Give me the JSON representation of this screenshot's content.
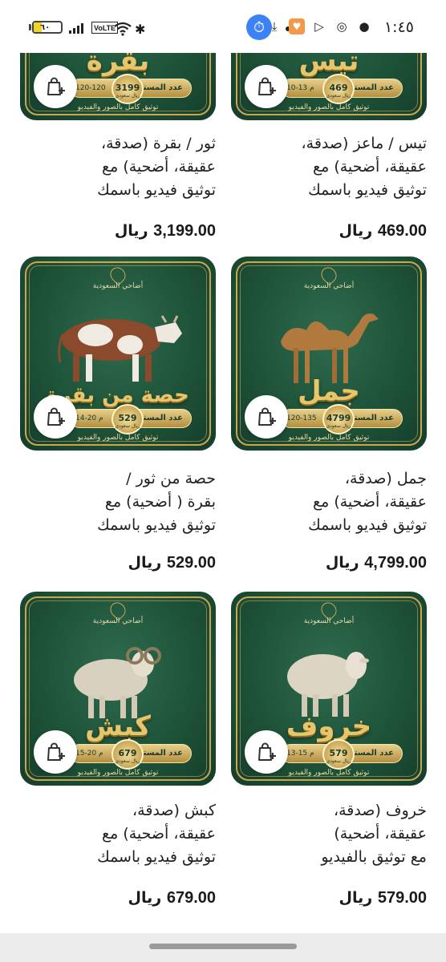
{
  "status_bar": {
    "time": "١:٤٥",
    "battery": "٦٠",
    "network": "VoLTE",
    "network_sup": "7"
  },
  "products": [
    {
      "animal": "cow",
      "banner": "بقرة",
      "title_lines": [
        "ثور / بقرة (صدقة،",
        "عقيقة، أضحية) مع",
        "توثيق فيديو باسمك"
      ],
      "price": "3,199.00",
      "currency": "ريال",
      "badge_number": "3199",
      "badge_currency": "ريال سعودي",
      "beneficiaries_label": "عدد المستفيدين",
      "beneficiaries_range": "120-120",
      "footer": "توثيق كامل بالصور والفيديو"
    },
    {
      "animal": "goat",
      "banner": "تيس",
      "title_lines": [
        "تيس / ماعز (صدقة،",
        "عقيقة، أضحية) مع",
        "توثيق فيديو باسمك"
      ],
      "price": "469.00",
      "currency": "ريال",
      "badge_number": "469",
      "badge_currency": "ريال سعودي",
      "beneficiaries_label": "عدد المستفيدين",
      "beneficiaries_range": "10-13 م",
      "footer": "توثيق كامل بالصور والفيديو"
    },
    {
      "animal": "cow-share",
      "banner": "حصة من بقرة",
      "brand": "أضاحي السعودية",
      "title_lines": [
        "حصة من ثور /",
        "بقرة ( أضحية) مع",
        "توثيق فيديو باسمك"
      ],
      "price": "529.00",
      "currency": "ريال",
      "badge_number": "529",
      "badge_currency": "ريال سعودي",
      "beneficiaries_label": "عدد المستفيدين",
      "beneficiaries_range": "14-20 م",
      "footer": "توثيق كامل بالصور والفيديو"
    },
    {
      "animal": "camel",
      "banner": "جمل",
      "brand": "أضاحي السعودية",
      "title_lines": [
        "جمل (صدقة،",
        "عقيقة، أضحية) مع",
        "توثيق فيديو باسمك"
      ],
      "price": "4,799.00",
      "currency": "ريال",
      "badge_number": "4799",
      "badge_currency": "ريال سعودي",
      "beneficiaries_label": "عدد المستفيدين",
      "beneficiaries_range": "120-135",
      "footer": "توثيق كامل بالصور والفيديو"
    },
    {
      "animal": "ram",
      "banner": "كبش",
      "brand": "أضاحي السعودية",
      "title_lines": [
        "كبش (صدقة،",
        "عقيقة، أضحية) مع",
        "توثيق فيديو باسمك"
      ],
      "price": "679.00",
      "currency": "ريال",
      "badge_number": "679",
      "badge_currency": "ريال سعودي",
      "beneficiaries_label": "عدد المستفيدين",
      "beneficiaries_range": "15-20 م",
      "footer": "توثيق كامل بالصور والفيديو"
    },
    {
      "animal": "sheep",
      "banner": "خروف",
      "brand": "أضاحي السعودية",
      "title_lines": [
        "خروف (صدقة،",
        "عقيقة، أضحية)",
        "مع توثيق بالفيديو"
      ],
      "price": "579.00",
      "currency": "ريال",
      "badge_number": "579",
      "badge_currency": "ريال سعودي",
      "beneficiaries_label": "عدد المستفيدين",
      "beneficiaries_range": "13-15 م",
      "footer": "توثيق كامل بالصور والفيديو"
    }
  ],
  "colors": {
    "card_green": "#1e5339",
    "gold": "#c9a752"
  }
}
